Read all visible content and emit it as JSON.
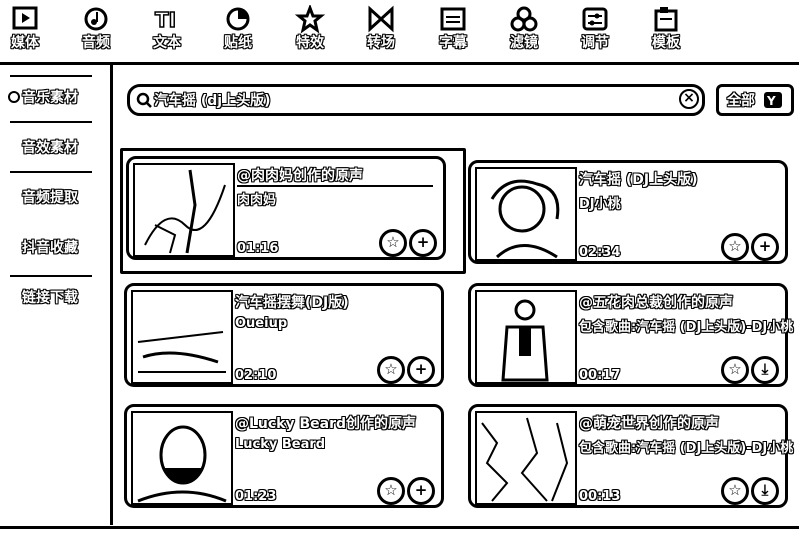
{
  "toolbar": {
    "items": [
      {
        "label": "媒体",
        "icon": "media-icon"
      },
      {
        "label": "音频",
        "icon": "audio-icon"
      },
      {
        "label": "文本",
        "icon": "text-icon"
      },
      {
        "label": "贴纸",
        "icon": "sticker-icon"
      },
      {
        "label": "特效",
        "icon": "effects-icon"
      },
      {
        "label": "转场",
        "icon": "transition-icon"
      },
      {
        "label": "字幕",
        "icon": "subtitle-icon"
      },
      {
        "label": "滤镜",
        "icon": "filter-icon"
      },
      {
        "label": "调节",
        "icon": "adjust-icon"
      },
      {
        "label": "模板",
        "icon": "template-icon"
      }
    ]
  },
  "sidebar": {
    "items": [
      {
        "label": "音乐素材",
        "active": true
      },
      {
        "label": "音效素材"
      },
      {
        "label": "音频提取"
      },
      {
        "label": "抖音收藏"
      },
      {
        "label": "链接下载"
      }
    ]
  },
  "search": {
    "value": "汽车摇 (dj上头版)",
    "filter_label": "全部"
  },
  "cards": [
    {
      "title": "@肉肉妈创作的原声",
      "subtitle": "肉肉妈",
      "duration": "01:16",
      "action": "add"
    },
    {
      "title": "汽车摇 (DJ上头版)",
      "subtitle": "DJ小桃",
      "duration": "02:34",
      "action": "add"
    },
    {
      "title": "汽车摇摆舞(DJ版)",
      "subtitle": "Oueiup",
      "duration": "02:10",
      "action": "add"
    },
    {
      "title": "@五花肉总裁创作的原声",
      "subtitle": "包含歌曲:汽车摇 (DJ上头版)-DJ小桃",
      "duration": "00:17",
      "action": "download"
    },
    {
      "title": "@Lucky Beard创作的原声",
      "subtitle": "Lucky Beard",
      "duration": "01:23",
      "action": "add"
    },
    {
      "title": "@萌宠世界创作的原声",
      "subtitle": "包含歌曲:汽车摇 (DJ上头版)-DJ小桃",
      "duration": "00:13",
      "action": "download"
    }
  ]
}
